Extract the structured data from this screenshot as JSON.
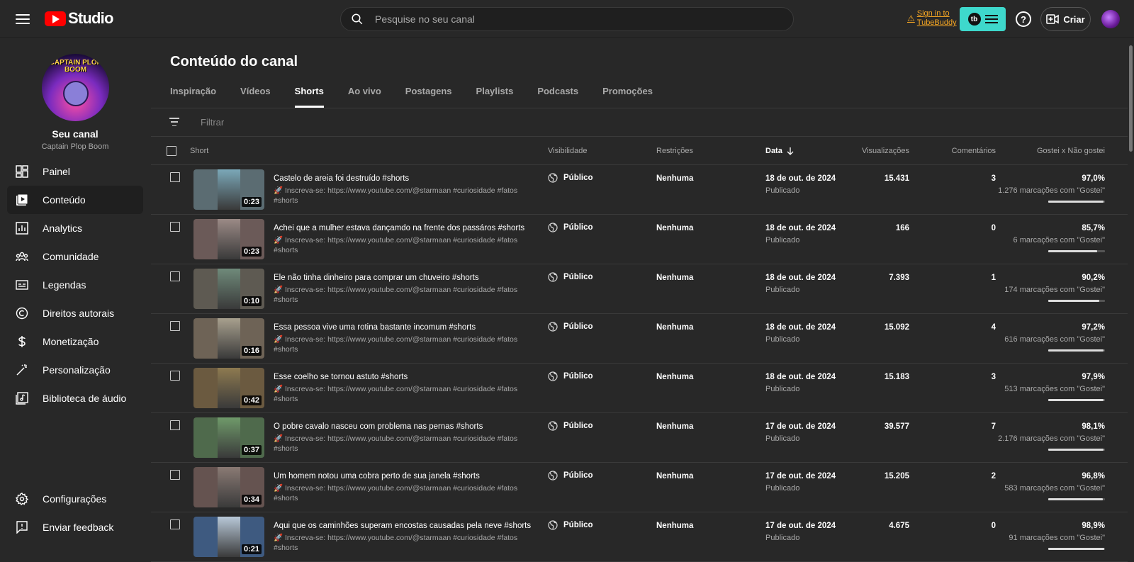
{
  "topbar": {
    "logo_text": "Studio",
    "search_placeholder": "Pesquise no seu canal",
    "tubebuddy_sign_line1": "Sign in to",
    "tubebuddy_sign_line2": "TubeBuddy",
    "tubebuddy_logo": "tb",
    "help_symbol": "?",
    "create_label": "Criar"
  },
  "sidebar": {
    "avatar_text": "CAPTAIN PLOP BOOM",
    "channel_title": "Seu canal",
    "channel_name": "Captain Plop Boom",
    "items": [
      {
        "label": "Painel",
        "icon": "dashboard-icon"
      },
      {
        "label": "Conteúdo",
        "icon": "content-icon",
        "active": true
      },
      {
        "label": "Analytics",
        "icon": "analytics-icon"
      },
      {
        "label": "Comunidade",
        "icon": "community-icon"
      },
      {
        "label": "Legendas",
        "icon": "subtitles-icon"
      },
      {
        "label": "Direitos autorais",
        "icon": "copyright-icon"
      },
      {
        "label": "Monetização",
        "icon": "dollar-icon"
      },
      {
        "label": "Personalização",
        "icon": "magic-wand-icon"
      },
      {
        "label": "Biblioteca de áudio",
        "icon": "audio-library-icon"
      }
    ],
    "bottom_items": [
      {
        "label": "Configurações",
        "icon": "gear-icon"
      },
      {
        "label": "Enviar feedback",
        "icon": "feedback-icon"
      }
    ]
  },
  "main": {
    "title": "Conteúdo do canal",
    "tabs": [
      "Inspiração",
      "Vídeos",
      "Shorts",
      "Ao vivo",
      "Postagens",
      "Playlists",
      "Podcasts",
      "Promoções"
    ],
    "active_tab": "Shorts",
    "filter_placeholder": "Filtrar",
    "columns": {
      "short": "Short",
      "visibility": "Visibilidade",
      "restrictions": "Restrições",
      "date": "Data",
      "views": "Visualizações",
      "comments": "Comentários",
      "likes": "Gostei x Não gostei"
    },
    "rows": [
      {
        "title": "Castelo de areia foi destruído #shorts",
        "desc": "🚀 Inscreva-se: https://www.youtube.com/@starmaan #curiosidade #fatos #shorts",
        "duration": "0:23",
        "visibility": "Público",
        "restrictions": "Nenhuma",
        "date": "18 de out. de 2024",
        "status": "Publicado",
        "views": "15.431",
        "comments": "3",
        "likes_pct": "97,0%",
        "likes_count": "1.276 marcações com \"Gostei\"",
        "likes_ratio": 0.97,
        "thumb_color": "#5b6c72",
        "pic_color": "#7ba8b8"
      },
      {
        "title": "Achei que a mulher estava dançamdo na frente dos passáros #shorts",
        "desc": "🚀 Inscreva-se: https://www.youtube.com/@starmaan #curiosidade #fatos #shorts",
        "duration": "0:23",
        "visibility": "Público",
        "restrictions": "Nenhuma",
        "date": "18 de out. de 2024",
        "status": "Publicado",
        "views": "166",
        "comments": "0",
        "likes_pct": "85,7%",
        "likes_count": "6 marcações com \"Gostei\"",
        "likes_ratio": 0.857,
        "thumb_color": "#6b5a58",
        "pic_color": "#9b8a86"
      },
      {
        "title": "Ele não tinha dinheiro para comprar um chuveiro #shorts",
        "desc": "🚀 Inscreva-se: https://www.youtube.com/@starmaan #curiosidade #fatos #shorts",
        "duration": "0:10",
        "visibility": "Público",
        "restrictions": "Nenhuma",
        "date": "18 de out. de 2024",
        "status": "Publicado",
        "views": "7.393",
        "comments": "1",
        "likes_pct": "90,2%",
        "likes_count": "174 marcações com \"Gostei\"",
        "likes_ratio": 0.902,
        "thumb_color": "#5e5a52",
        "pic_color": "#6f8a7a"
      },
      {
        "title": "Essa pessoa vive uma rotina bastante incomum #shorts",
        "desc": "🚀 Inscreva-se: https://www.youtube.com/@starmaan #curiosidade #fatos #shorts",
        "duration": "0:16",
        "visibility": "Público",
        "restrictions": "Nenhuma",
        "date": "18 de out. de 2024",
        "status": "Publicado",
        "views": "15.092",
        "comments": "4",
        "likes_pct": "97,2%",
        "likes_count": "616 marcações com \"Gostei\"",
        "likes_ratio": 0.972,
        "thumb_color": "#6e6356",
        "pic_color": "#a8a08e"
      },
      {
        "title": "Esse coelho se tornou astuto #shorts",
        "desc": "🚀 Inscreva-se: https://www.youtube.com/@starmaan #curiosidade #fatos #shorts",
        "duration": "0:42",
        "visibility": "Público",
        "restrictions": "Nenhuma",
        "date": "18 de out. de 2024",
        "status": "Publicado",
        "views": "15.183",
        "comments": "3",
        "likes_pct": "97,9%",
        "likes_count": "513 marcações com \"Gostei\"",
        "likes_ratio": 0.979,
        "thumb_color": "#6b5a40",
        "pic_color": "#8e7a50"
      },
      {
        "title": "O pobre cavalo nasceu com problema nas pernas #shorts",
        "desc": "🚀 Inscreva-se: https://www.youtube.com/@starmaan #curiosidade #fatos #shorts",
        "duration": "0:37",
        "visibility": "Público",
        "restrictions": "Nenhuma",
        "date": "17 de out. de 2024",
        "status": "Publicado",
        "views": "39.577",
        "comments": "7",
        "likes_pct": "98,1%",
        "likes_count": "2.176 marcações com \"Gostei\"",
        "likes_ratio": 0.981,
        "thumb_color": "#4f6a4c",
        "pic_color": "#6f9a6a"
      },
      {
        "title": "Um homem notou uma cobra perto de sua janela #shorts",
        "desc": "🚀 Inscreva-se: https://www.youtube.com/@starmaan #curiosidade #fatos #shorts",
        "duration": "0:34",
        "visibility": "Público",
        "restrictions": "Nenhuma",
        "date": "17 de out. de 2024",
        "status": "Publicado",
        "views": "15.205",
        "comments": "2",
        "likes_pct": "96,8%",
        "likes_count": "583 marcações com \"Gostei\"",
        "likes_ratio": 0.968,
        "thumb_color": "#655350",
        "pic_color": "#8a7a74"
      },
      {
        "title": "Aqui que os caminhões superam encostas causadas pela neve #shorts",
        "desc": "🚀 Inscreva-se: https://www.youtube.com/@starmaan #curiosidade #fatos #shorts",
        "duration": "0:21",
        "visibility": "Público",
        "restrictions": "Nenhuma",
        "date": "17 de out. de 2024",
        "status": "Publicado",
        "views": "4.675",
        "comments": "0",
        "likes_pct": "98,9%",
        "likes_count": "91 marcações com \"Gostei\"",
        "likes_ratio": 0.989,
        "thumb_color": "#3e5a80",
        "pic_color": "#b8c8d8"
      }
    ]
  }
}
